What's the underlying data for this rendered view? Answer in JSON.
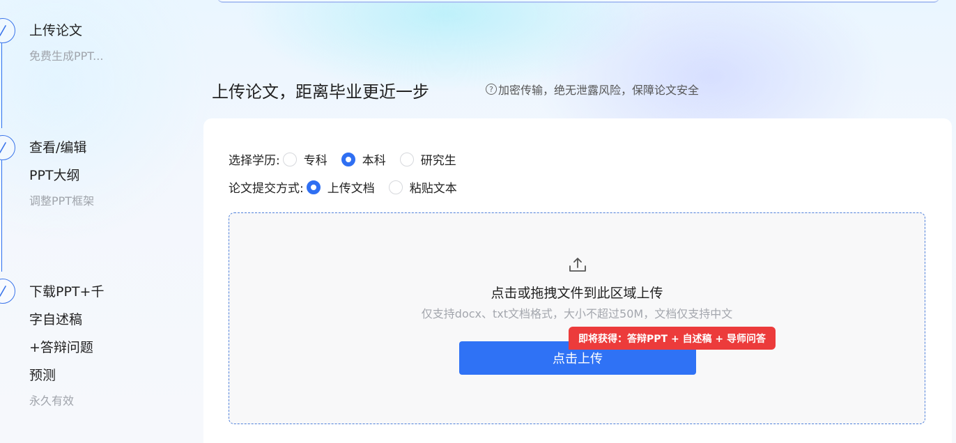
{
  "steps": [
    {
      "title_lines": [
        "上传论文"
      ],
      "sub": "免费生成PPT..."
    },
    {
      "title_lines": [
        "查看/编辑",
        "PPT大纲"
      ],
      "sub": "调整PPT框架"
    },
    {
      "title_lines": [
        "下载PPT+千",
        "字自述稿",
        "+答辩问题",
        "预测"
      ],
      "sub": "永久有效"
    }
  ],
  "header": {
    "title": "上传论文，距离毕业更近一步",
    "security_icon": "?",
    "security_note": "加密传输，绝无泄露风险，保障论文安全"
  },
  "form": {
    "education": {
      "label": "选择学历:",
      "options": [
        "专科",
        "本科",
        "研究生"
      ],
      "selected": "本科"
    },
    "submit_method": {
      "label": "论文提交方式:",
      "options": [
        "上传文档",
        "粘贴文本"
      ],
      "selected": "上传文档"
    }
  },
  "dropzone": {
    "icon": "upload-icon",
    "main_text": "点击或拖拽文件到此区域上传",
    "hint": "仅支持docx、txt文档格式，大小不超过50M，文档仅支持中文",
    "button_label": "点击上传",
    "badge": "即将获得：答辩PPT + 自述稿 + 导师问答"
  },
  "colors": {
    "accent": "#2f72f5",
    "badge": "#ec3b3b",
    "dropzone_border": "#4d7fda"
  }
}
